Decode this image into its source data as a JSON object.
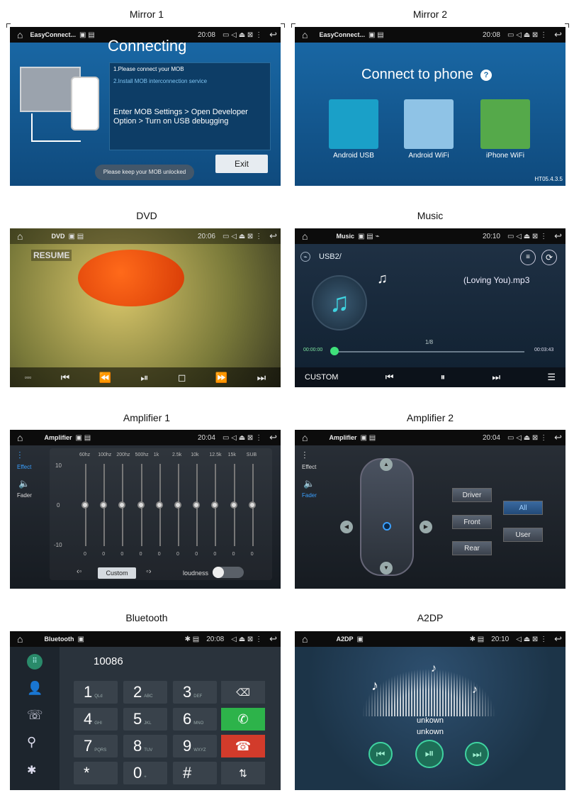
{
  "captions": {
    "mirror1": "Mirror 1",
    "mirror2": "Mirror 2",
    "dvd": "DVD",
    "music": "Music",
    "amp1": "Amplifier 1",
    "amp2": "Amplifier 2",
    "bluetooth": "Bluetooth",
    "a2dp": "A2DP"
  },
  "mirror1": {
    "app": "EasyConnect...",
    "time": "20:08",
    "title": "Connecting",
    "step1": "1.Please connect your MOB",
    "step2": "2.Install MOB interconnection service",
    "instruction": "Enter MOB Settings > Open Developer Option > Turn on USB debugging",
    "exit": "Exit",
    "toast": "Please keep your MOB unlocked"
  },
  "mirror2": {
    "app": "EasyConnect...",
    "time": "20:08",
    "title": "Connect to phone",
    "opt1": "Android USB",
    "opt2": "Android WiFi",
    "opt3": "iPhone WiFi",
    "version": "HT05.4.3.5"
  },
  "dvd": {
    "app": "DVD",
    "time": "20:06",
    "resume": "RESUME"
  },
  "music": {
    "app": "Music",
    "time": "20:10",
    "source": "USB2/",
    "track": "(Loving You).mp3",
    "index": "1/8",
    "elapsed": "00:00:00",
    "total": "00:03:43",
    "mode": "CUSTOM",
    "progress": 0.0
  },
  "amp1": {
    "app": "Amplifier",
    "time": "20:04",
    "effect": "Effect",
    "fader": "Fader",
    "bands": [
      "60hz",
      "100hz",
      "200hz",
      "500hz",
      "1k",
      "2.5k",
      "10k",
      "12.5k",
      "15k",
      "SUB"
    ],
    "values": [
      0,
      0,
      0,
      0,
      0,
      0,
      0,
      0,
      0,
      0
    ],
    "scale_top": "10",
    "scale_mid": "0",
    "scale_bot": "-10",
    "preset": "Custom",
    "loudness": "loudness"
  },
  "amp2": {
    "app": "Amplifier",
    "time": "20:04",
    "effect": "Effect",
    "fader": "Fader",
    "driver": "Driver",
    "all": "All",
    "front": "Front",
    "user": "User",
    "rear": "Rear"
  },
  "bluetooth": {
    "app": "Bluetooth",
    "time": "20:08",
    "number": "10086",
    "keys": [
      [
        "1",
        "QLd"
      ],
      [
        "2",
        "ABC"
      ],
      [
        "3",
        "DEF"
      ],
      [
        "4",
        "GHI"
      ],
      [
        "5",
        "JKL"
      ],
      [
        "6",
        "MNO"
      ],
      [
        "7",
        "PQRS"
      ],
      [
        "8",
        "TUV"
      ],
      [
        "9",
        "WXYZ"
      ],
      [
        "*",
        ""
      ],
      [
        "0",
        "+"
      ],
      [
        "#",
        ""
      ]
    ]
  },
  "a2dp": {
    "app": "A2DP",
    "time": "20:10",
    "line1": "unkown",
    "line2": "unkown"
  },
  "colors": {
    "teal": "#1aa0c8",
    "green": "#2db34a",
    "red": "#d23b2b"
  }
}
